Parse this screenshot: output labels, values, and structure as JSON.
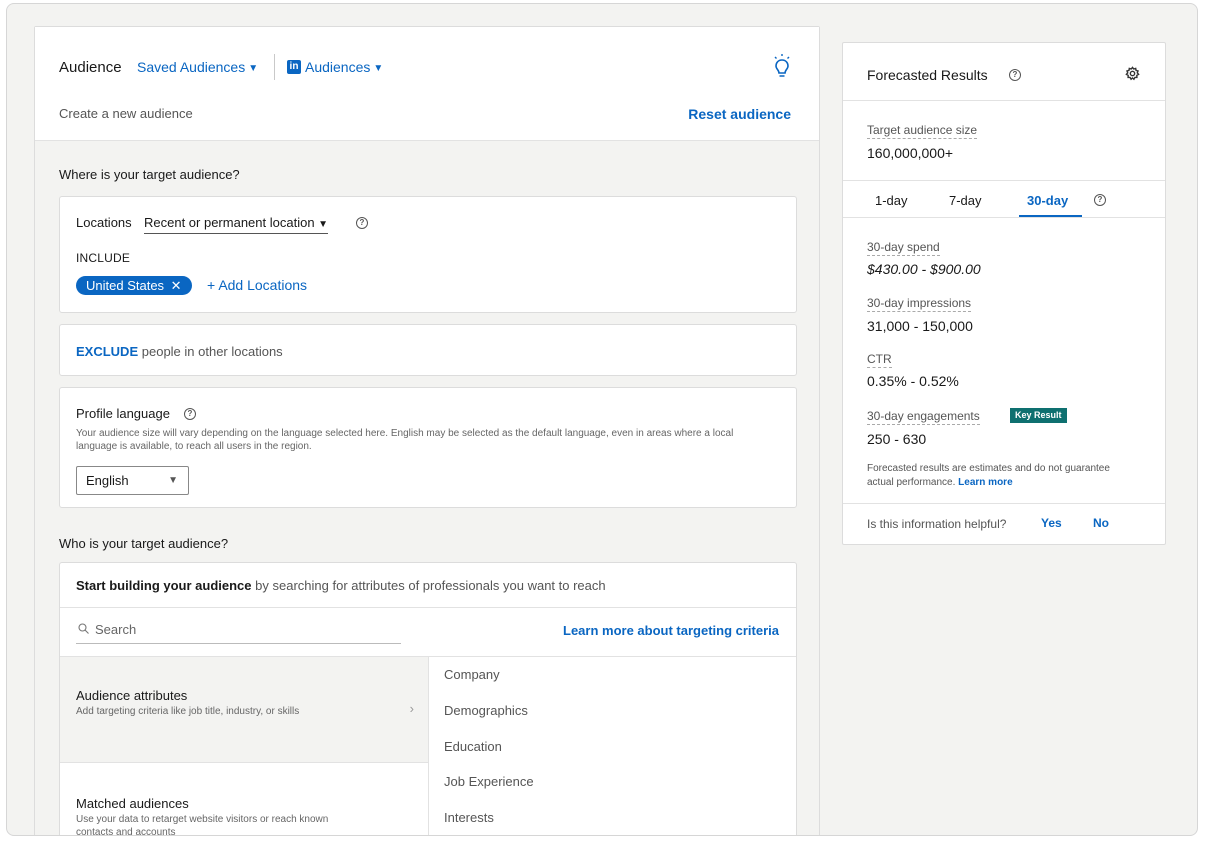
{
  "header": {
    "title": "Audience",
    "saved_audiences": "Saved Audiences",
    "linkedin_logo": "in",
    "audiences": "Audiences",
    "create_new": "Create a new audience",
    "reset": "Reset audience"
  },
  "where": {
    "question": "Where is your target audience?",
    "locations_label": "Locations",
    "location_type": "Recent or permanent location",
    "include_label": "INCLUDE",
    "chip": "United States",
    "add_locations": "Add Locations",
    "exclude_keyword": "EXCLUDE",
    "exclude_rest": "people in other locations"
  },
  "profile_language": {
    "title": "Profile language",
    "description": "Your audience size will vary depending on the language selected here. English may be selected as the default language, even in areas where a local language is available, to reach all users in the region.",
    "selected": "English"
  },
  "who": {
    "question": "Who is your target audience?",
    "start_bold": "Start building your audience",
    "start_rest": "by searching for attributes of professionals you want to reach",
    "search_placeholder": "Search",
    "learn_more": "Learn more about targeting criteria",
    "attributes": [
      {
        "title": "Audience attributes",
        "desc": "Add targeting criteria like job title, industry, or skills"
      },
      {
        "title": "Matched audiences",
        "desc": "Use your data to retarget website visitors or reach known contacts and accounts"
      }
    ],
    "categories": [
      "Company",
      "Demographics",
      "Education",
      "Job Experience",
      "Interests"
    ]
  },
  "forecast": {
    "title": "Forecasted Results",
    "target_label": "Target audience size",
    "target_value": "160,000,000+",
    "tabs": [
      "1-day",
      "7-day",
      "30-day"
    ],
    "active_tab": "30-day",
    "spend_label": "30-day spend",
    "spend_value": "$430.00 - $900.00",
    "impressions_label": "30-day impressions",
    "impressions_value": "31,000 - 150,000",
    "ctr_label": "CTR",
    "ctr_value": "0.35% - 0.52%",
    "engagements_label": "30-day engagements",
    "key_result": "Key Result",
    "engagements_value": "250 - 630",
    "disclaimer": "Forecasted results are estimates and do not guarantee actual performance.",
    "learn_more": "Learn more",
    "helpful_q": "Is this information helpful?",
    "yes": "Yes",
    "no": "No"
  },
  "colors": {
    "accent": "#0a66c2",
    "key_result_badge": "#0e7070",
    "background": "#f3f3f1"
  },
  "icons": [
    "lightbulb-icon",
    "help-circle-icon",
    "gear-icon",
    "search-icon",
    "close-icon",
    "plus-icon",
    "caret-down-icon",
    "chevron-right-icon"
  ]
}
